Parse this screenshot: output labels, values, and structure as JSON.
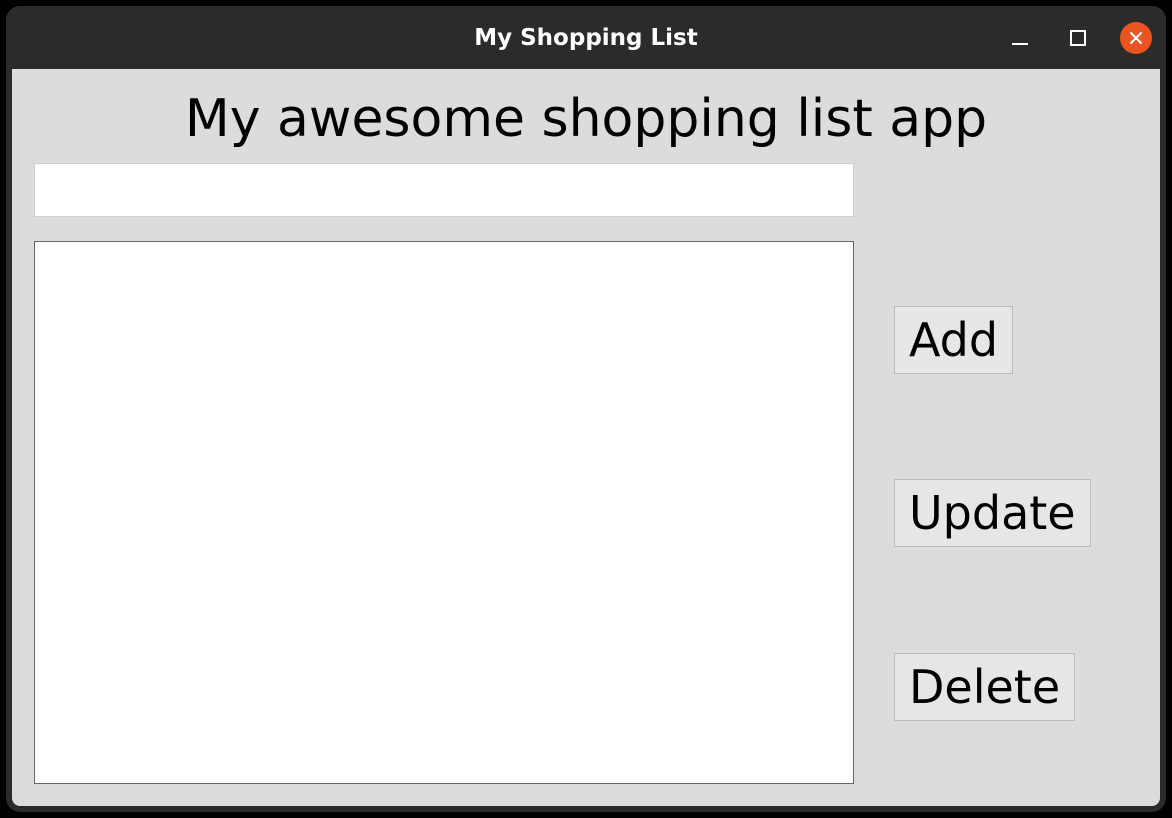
{
  "window": {
    "title": "My Shopping List"
  },
  "app": {
    "heading": "My awesome shopping list app"
  },
  "input": {
    "value": "",
    "placeholder": ""
  },
  "list": {
    "items": []
  },
  "buttons": {
    "add": "Add",
    "update": "Update",
    "delete": "Delete"
  }
}
